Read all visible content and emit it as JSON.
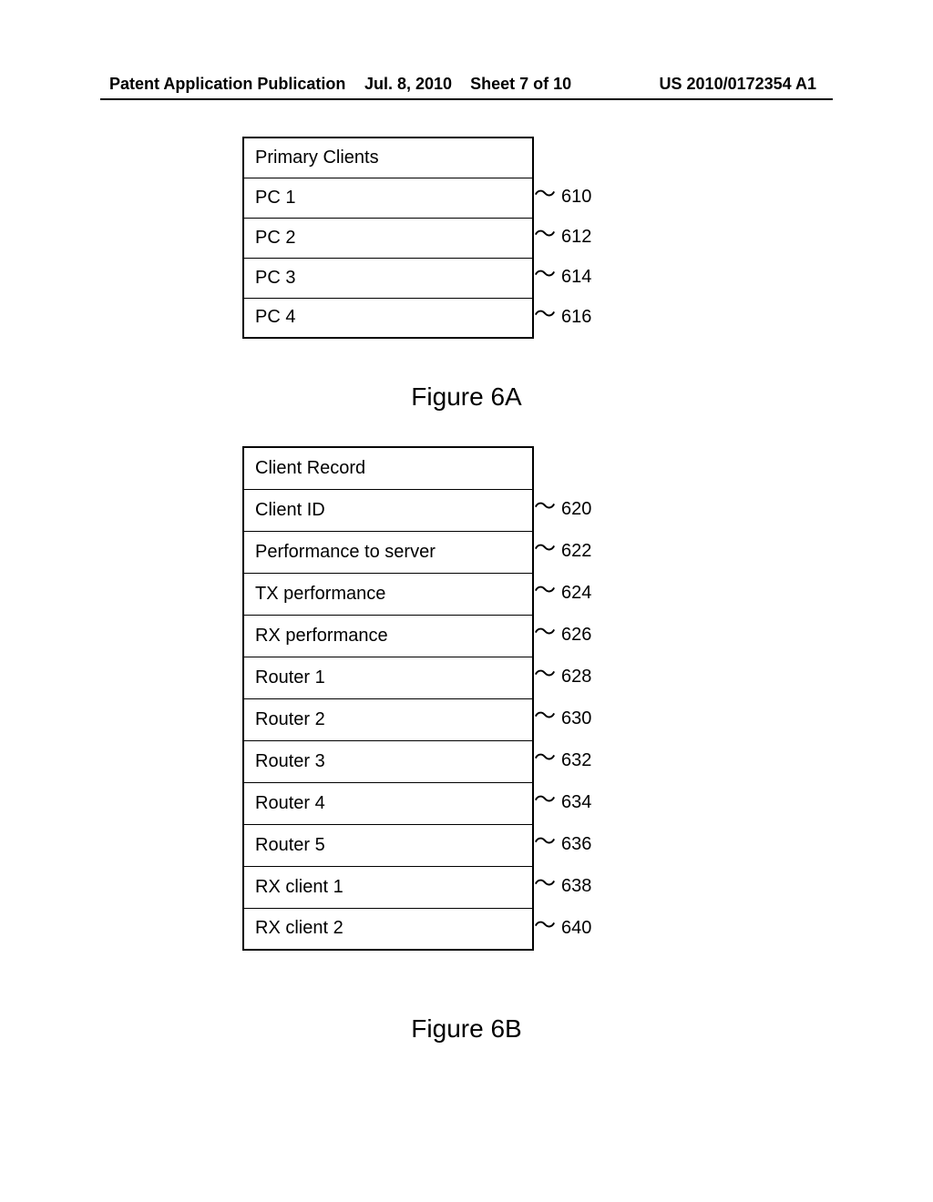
{
  "header": {
    "left": "Patent Application Publication",
    "mid_date": "Jul. 8, 2010",
    "mid_sheet": "Sheet 7 of 10",
    "right": "US 2010/0172354 A1"
  },
  "figA": {
    "caption": "Figure 6A",
    "title": "Primary Clients",
    "rows": [
      {
        "label": "PC 1",
        "ref": "610"
      },
      {
        "label": "PC 2",
        "ref": "612"
      },
      {
        "label": "PC 3",
        "ref": "614"
      },
      {
        "label": "PC 4",
        "ref": "616"
      }
    ]
  },
  "figB": {
    "caption": "Figure 6B",
    "title": "Client Record",
    "rows": [
      {
        "label": "Client ID",
        "ref": "620"
      },
      {
        "label": "Performance to server",
        "ref": "622"
      },
      {
        "label": "TX performance",
        "ref": "624"
      },
      {
        "label": "RX performance",
        "ref": "626"
      },
      {
        "label": "Router 1",
        "ref": "628"
      },
      {
        "label": "Router 2",
        "ref": "630"
      },
      {
        "label": "Router 3",
        "ref": "632"
      },
      {
        "label": "Router 4",
        "ref": "634"
      },
      {
        "label": "Router 5",
        "ref": "636"
      },
      {
        "label": "RX client 1",
        "ref": "638"
      },
      {
        "label": "RX client 2",
        "ref": "640"
      }
    ]
  }
}
